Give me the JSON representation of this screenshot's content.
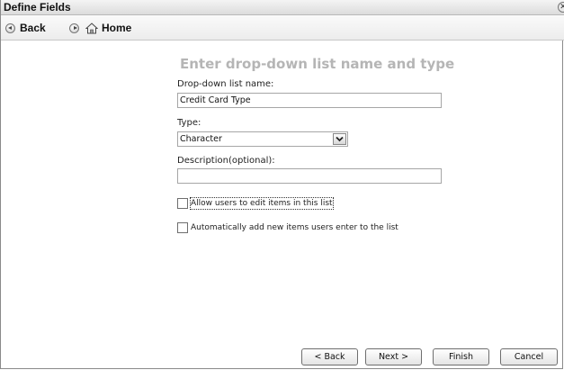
{
  "window": {
    "title": "Define Fields"
  },
  "nav": {
    "back_label": "Back",
    "home_label": "Home"
  },
  "form": {
    "heading": "Enter drop-down list name and type",
    "name_label": "Drop-down list name:",
    "name_value": "Credit Card Type",
    "type_label": "Type:",
    "type_value": "Character",
    "description_label": "Description(optional):",
    "description_value": "",
    "allow_edit_label": "Allow users to edit items in this list",
    "allow_edit_checked": false,
    "auto_add_label": "Automatically add new items users enter to the list",
    "auto_add_checked": false
  },
  "buttons": {
    "back": "< Back",
    "next": "Next >",
    "finish": "Finish",
    "cancel": "Cancel"
  },
  "icons": {
    "close": "close-icon",
    "back": "back-arrow-icon",
    "forward": "forward-arrow-icon",
    "home": "home-icon",
    "dropdown": "chevron-down-icon"
  }
}
